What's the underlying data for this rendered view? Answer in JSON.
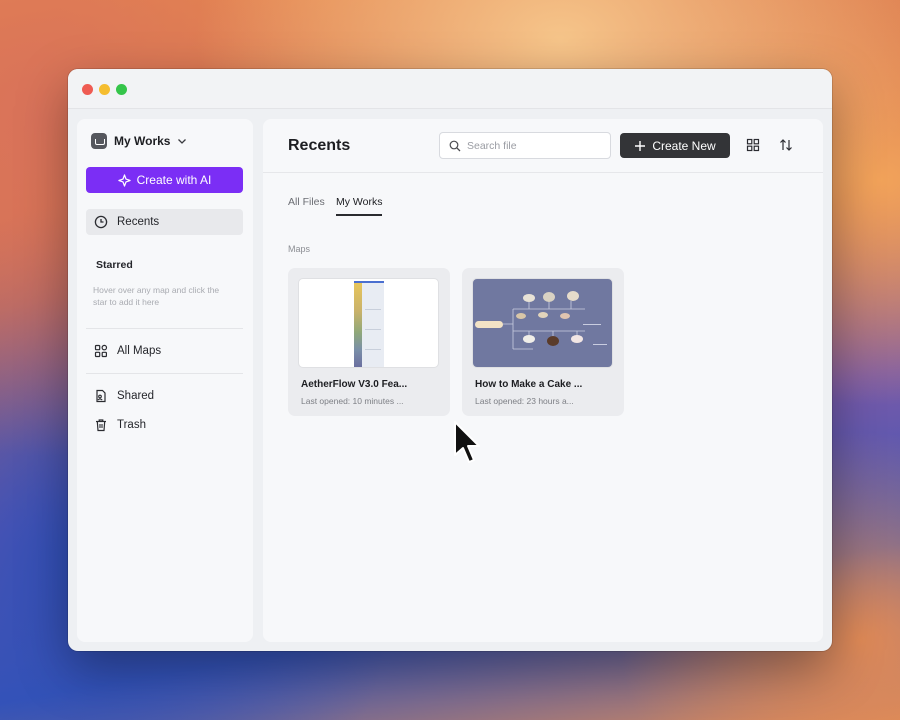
{
  "window": {
    "traffic_lights": [
      "close",
      "minimize",
      "maximize"
    ]
  },
  "sidebar": {
    "workspace_label": "My Works",
    "create_ai_label": "Create with AI",
    "nav": {
      "recents": "Recents",
      "starred": "Starred",
      "starred_hint": "Hover over any map and click the star to add it here",
      "all_maps": "All Maps",
      "shared": "Shared",
      "trash": "Trash"
    }
  },
  "main": {
    "title": "Recents",
    "search_placeholder": "Search file",
    "create_new_label": "Create New",
    "tabs": [
      "All Files",
      "My Works"
    ],
    "active_tab": "My Works",
    "section_label": "Maps",
    "cards": [
      {
        "title": "AetherFlow V3.0 Fea...",
        "subtitle": "Last opened: 10 minutes ..."
      },
      {
        "title": "How to Make a Cake ...",
        "subtitle": "Last opened: 23 hours a..."
      }
    ]
  },
  "colors": {
    "accent_purple": "#7b2ef5",
    "create_button": "#333437",
    "thumb_bg": "#7078a0"
  }
}
